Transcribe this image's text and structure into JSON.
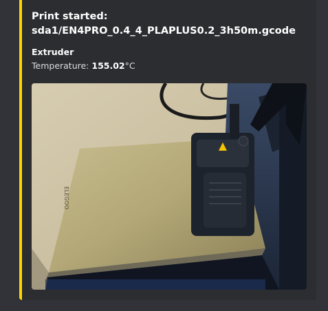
{
  "embed": {
    "accent_color": "#ffd600",
    "title_line1": "Print started:",
    "title_line2": "sda1/EN4PRO_0.4_4_PLAPLUS0.2_3h50m.gcode",
    "field": {
      "name": "Extruder",
      "value_label": "Temperature: ",
      "value_number": "155.02",
      "value_unit": "°C"
    },
    "image": {
      "bed_logo_text": "ELEGOO",
      "alt": "3D printer bed photo"
    }
  }
}
